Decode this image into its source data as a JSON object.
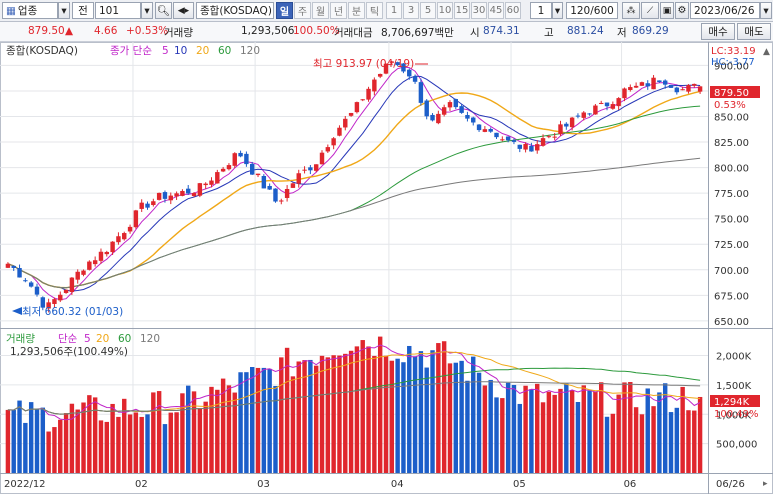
{
  "toolbar": {
    "market_label": "업종",
    "market_code_label": "전",
    "code_value": "101",
    "index_name": "종합(KOSDAQ)",
    "periods": [
      "일",
      "주",
      "월",
      "년",
      "분",
      "틱"
    ],
    "active_period": "일",
    "intervals": [
      "1",
      "3",
      "5",
      "10",
      "15",
      "30",
      "45",
      "60"
    ],
    "interval_value": "1",
    "count_value": "120/600",
    "date_value": "2023/06/26"
  },
  "info_bar": {
    "price": "879.50",
    "change_arrow": "▲",
    "change": "4.66",
    "change_pct": "+0.53%",
    "volume_label": "거래량",
    "volume": "1,293,506",
    "volume_ratio": "100.50%",
    "amount_label": "거래대금",
    "amount": "8,706,697백만",
    "open_label": "시",
    "open": "874.31",
    "high_label": "고",
    "high": "881.24",
    "low_label": "저",
    "low": "869.29"
  },
  "actions": {
    "buy_label": "매수",
    "sell_label": "매도"
  },
  "price_panel": {
    "legend_name": "종합(KOSDAQ)",
    "legend_type": "종가 단순",
    "ma_periods": [
      "5",
      "10",
      "20",
      "60",
      "120"
    ],
    "ma_colors": [
      "#c026c9",
      "#2838b8",
      "#f0a818",
      "#2c9a3c",
      "#7a7a7a"
    ],
    "lc_label": "LC:33.19",
    "hc_label": "HC:-3.77",
    "high_annotation": "최고 913.97 (04/19)",
    "low_annotation": "최저 660.32 (01/03)",
    "last_price_tag": "879.50",
    "last_pct_tag": "0.53%",
    "y_ticks": [
      "900.00",
      "875.00",
      "850.00",
      "825.00",
      "800.00",
      "775.00",
      "750.00",
      "725.00",
      "700.00",
      "675.00",
      "650.00"
    ]
  },
  "volume_panel": {
    "legend_name": "거래량",
    "legend_type": "단순",
    "ma_periods": [
      "5",
      "20",
      "60",
      "120"
    ],
    "ma_colors": [
      "#c026c9",
      "#f0a818",
      "#2c9a3c",
      "#7a7a7a"
    ],
    "volume_text": "1,293,506주(100.49%)",
    "last_volume_tag": "1,294K",
    "last_pct_tag": "100.49%",
    "y_ticks": [
      "2,000K",
      "1,500K",
      "1,000K",
      "500,000"
    ]
  },
  "x_axis": {
    "labels": [
      "2022/12",
      "02",
      "03",
      "04",
      "05",
      "06"
    ],
    "right_label": "06/26"
  },
  "colors": {
    "up": "#e0262d",
    "down": "#1c5ec9",
    "grid": "#e4e6ea",
    "panel_border": "#9aa3b2"
  },
  "chart_data": {
    "type": "candlestick",
    "period": "daily",
    "bars_shown": 120,
    "ylim_price": [
      645,
      918
    ],
    "ylim_volume": [
      0,
      2400
    ],
    "volume_units": "K shares",
    "price_keypoints": [
      {
        "date": "2022/12/20",
        "close": 706
      },
      {
        "date": "2022/12/27",
        "close": 690
      },
      {
        "date": "2023/01/03",
        "close": 662
      },
      {
        "date": "2023/01/06",
        "close": 682
      },
      {
        "date": "2023/01/12",
        "close": 705
      },
      {
        "date": "2023/01/18",
        "close": 718
      },
      {
        "date": "2023/01/25",
        "close": 738
      },
      {
        "date": "2023/02/01",
        "close": 762
      },
      {
        "date": "2023/02/08",
        "close": 772
      },
      {
        "date": "2023/02/15",
        "close": 775
      },
      {
        "date": "2023/02/22",
        "close": 780
      },
      {
        "date": "2023/02/28",
        "close": 797
      },
      {
        "date": "2023/03/06",
        "close": 815
      },
      {
        "date": "2023/03/10",
        "close": 790
      },
      {
        "date": "2023/03/14",
        "close": 765
      },
      {
        "date": "2023/03/17",
        "close": 790
      },
      {
        "date": "2023/03/23",
        "close": 805
      },
      {
        "date": "2023/03/29",
        "close": 835
      },
      {
        "date": "2023/04/05",
        "close": 855
      },
      {
        "date": "2023/04/12",
        "close": 885
      },
      {
        "date": "2023/04/19",
        "close": 905
      },
      {
        "date": "2023/04/24",
        "close": 890
      },
      {
        "date": "2023/04/26",
        "close": 842
      },
      {
        "date": "2023/04/28",
        "close": 860
      },
      {
        "date": "2023/05/04",
        "close": 845
      },
      {
        "date": "2023/05/10",
        "close": 838
      },
      {
        "date": "2023/05/16",
        "close": 825
      },
      {
        "date": "2023/05/19",
        "close": 818
      },
      {
        "date": "2023/05/23",
        "close": 830
      },
      {
        "date": "2023/05/26",
        "close": 840
      },
      {
        "date": "2023/06/01",
        "close": 855
      },
      {
        "date": "2023/06/07",
        "close": 860
      },
      {
        "date": "2023/06/13",
        "close": 875
      },
      {
        "date": "2023/06/16",
        "close": 880
      },
      {
        "date": "2023/06/20",
        "close": 888
      },
      {
        "date": "2023/06/22",
        "close": 876
      },
      {
        "date": "2023/06/26",
        "close": 879.5
      }
    ],
    "volume_keypoints": [
      {
        "date": "2023/01",
        "volume": 950
      },
      {
        "date": "2023/02",
        "volume": 1050
      },
      {
        "date": "2023/03",
        "volume": 1150
      },
      {
        "date": "2023/04/14",
        "volume": 1700
      },
      {
        "date": "2023/04/20",
        "volume": 2300
      },
      {
        "date": "2023/04/24",
        "volume": 2000
      },
      {
        "date": "2023/05",
        "volume": 1300
      },
      {
        "date": "2023/06",
        "volume": 1250
      },
      {
        "date": "2023/06/26",
        "volume": 1294
      }
    ]
  }
}
